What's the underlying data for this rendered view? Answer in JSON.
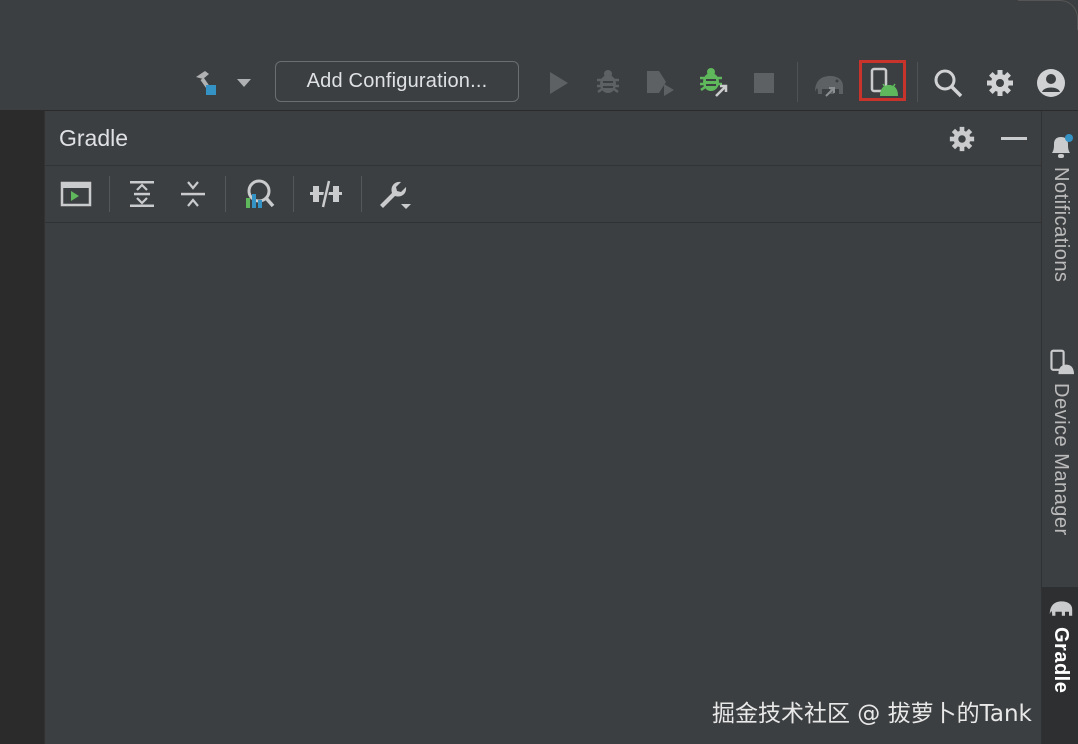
{
  "toolbar": {
    "add_configuration_label": "Add Configuration...",
    "icons": [
      "hammer-build-icon",
      "dropdown-arrow-icon",
      "run-icon",
      "debug-icon",
      "run-coverage-icon",
      "apply-changes-icon",
      "stop-icon",
      "gradle-sync-icon",
      "device-manager-icon",
      "search-icon",
      "settings-icon",
      "account-icon"
    ]
  },
  "gradle_panel": {
    "title": "Gradle",
    "toolbar_icons": [
      "execute-task-icon",
      "expand-all-icon",
      "collapse-all-icon",
      "analyze-dependencies-icon",
      "toggle-offline-icon",
      "build-tool-settings-icon"
    ]
  },
  "right_strip": {
    "tabs": [
      {
        "label": "Notifications",
        "icon": "bell-icon"
      },
      {
        "label": "Device Manager",
        "icon": "device-manager-icon"
      },
      {
        "label": "Gradle",
        "icon": "elephant-icon"
      }
    ]
  },
  "watermark": "掘金技术社区 @ 拔萝卜的Tank",
  "colors": {
    "background": "#3c3f41",
    "left_strip": "#2b2b2b",
    "highlight": "#c8342b",
    "android_green": "#5fb85c",
    "accent_blue": "#3592c4"
  }
}
